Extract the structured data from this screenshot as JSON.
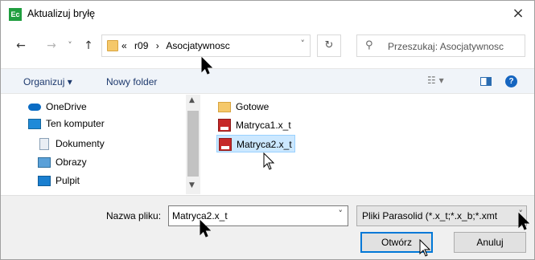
{
  "window": {
    "app_icon_text": "Ec",
    "title": "Aktualizuj bryłę",
    "close_glyph": "×"
  },
  "navigation": {
    "back_glyph": "←",
    "forward_glyph": "→",
    "history_glyph": "˅",
    "up_glyph": "↑",
    "breadcrumb": [
      "«",
      "r09",
      "›",
      "Asocjatywnosc"
    ],
    "address_dropdown_glyph": "˅",
    "refresh_glyph": "↻",
    "search_icon": "search-icon",
    "search_glyph": "⚲",
    "search_placeholder": "Przeszukaj: Asocjatywnosc"
  },
  "toolbar": {
    "organize_label": "Organizuj ▾",
    "new_folder_label": "Nowy folder",
    "view_glyph": "☷ ▾",
    "help_glyph": "?"
  },
  "sidebar": {
    "items": [
      {
        "label": "OneDrive",
        "icon": "cloud-icon"
      },
      {
        "label": "Ten komputer",
        "icon": "computer-icon"
      },
      {
        "label": "Dokumenty",
        "icon": "documents-icon"
      },
      {
        "label": "Obrazy",
        "icon": "pictures-icon"
      },
      {
        "label": "Pulpit",
        "icon": "desktop-icon"
      }
    ],
    "scroll_up_glyph": "▲",
    "scroll_down_glyph": "▼"
  },
  "files": [
    {
      "name": "Gotowe",
      "icon": "folder-icon",
      "selected": false
    },
    {
      "name": "Matryca1.x_t",
      "icon": "parasolid-file-icon",
      "selected": false
    },
    {
      "name": "Matryca2.x_t",
      "icon": "parasolid-file-icon",
      "selected": true
    }
  ],
  "footer": {
    "filename_label": "Nazwa pliku:",
    "filename_value": "Matryca2.x_t",
    "filename_dropdown_glyph": "˅",
    "filetype_value": "Pliki Parasolid (*.x_t;*.x_b;*.xmt",
    "filetype_dropdown_glyph": "˅",
    "open_label": "Otwórz",
    "cancel_label": "Anuluj"
  },
  "colors": {
    "accent": "#0078d7",
    "selection": "#cce8ff",
    "app_icon": "#1f9e3f"
  }
}
